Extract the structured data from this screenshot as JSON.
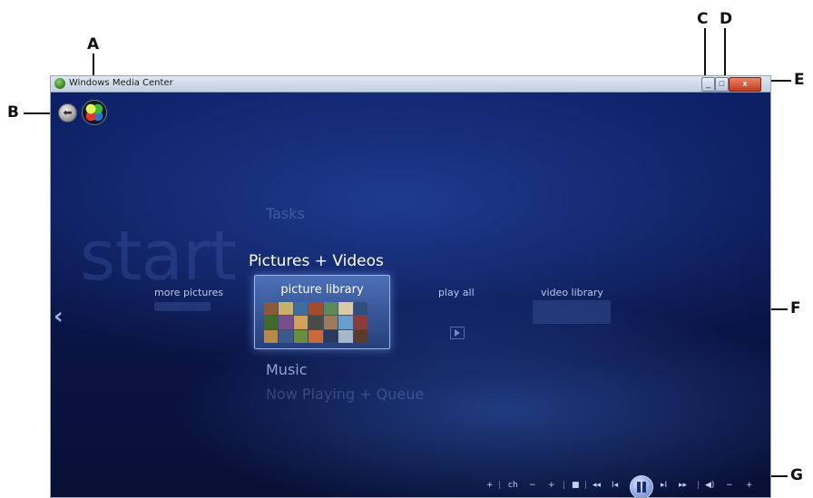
{
  "callouts": {
    "a": "A",
    "b": "B",
    "c": "C",
    "d": "D",
    "e": "E",
    "f": "F",
    "g": "G"
  },
  "window": {
    "title": "Windows Media Center",
    "minimize_icon": "minimize-icon",
    "maximize_icon": "maximize-icon",
    "close_glyph": "x"
  },
  "nav": {
    "back_glyph": "⬅",
    "start_orb_icon": "windows-start-orb-icon"
  },
  "watermark": "start",
  "menu": {
    "tasks": "Tasks",
    "section_title": "Pictures + Videos",
    "items": [
      {
        "label": "more pictures"
      },
      {
        "label": "picture library"
      },
      {
        "label": "play all"
      },
      {
        "label": "video library"
      }
    ],
    "music": "Music",
    "now_playing": "Now Playing + Queue",
    "left_arrow": "‹"
  },
  "transport": {
    "ch_label": "ch",
    "plus": "+",
    "minus": "−",
    "stop_glyph": "■",
    "rewind_glyph": "◂◂",
    "prev_glyph": "I◂",
    "next_glyph": "▸I",
    "ffwd_glyph": "▸▸",
    "volume_glyph": "◀)",
    "separator": "|"
  },
  "colors": {
    "background": "#0b1a56",
    "accent": "#9eb4e6",
    "text": "#ffffff"
  }
}
